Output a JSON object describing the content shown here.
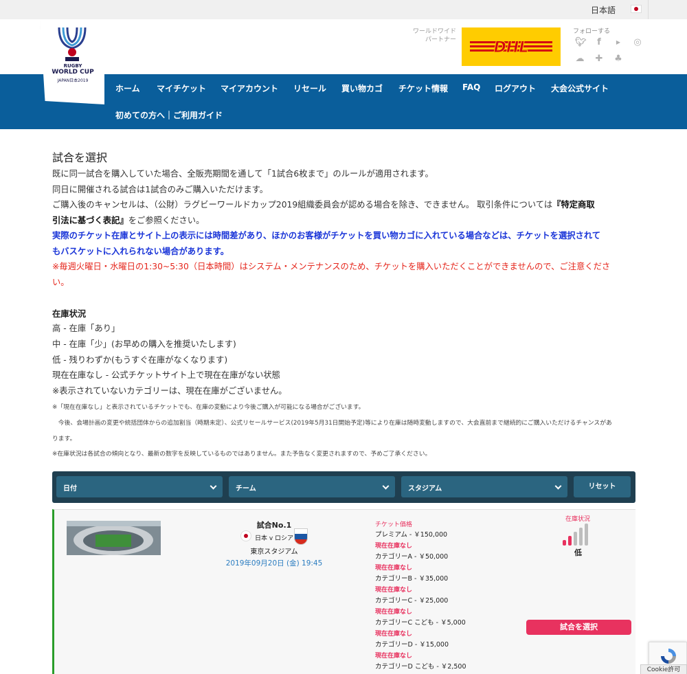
{
  "topbar": {
    "language": "日本語"
  },
  "logo": {
    "line1": "RUGBY",
    "line2": "WORLD CUP",
    "line3": "JAPAN日本2019"
  },
  "partner": {
    "label": "ワールドワイド パートナー",
    "sponsor": "DHL"
  },
  "social": {
    "label": "フォローする",
    "icons": [
      "twitter-icon",
      "facebook-icon",
      "youtube-icon",
      "instagram-icon",
      "soundcloud-icon",
      "plus-icon",
      "snapchat-icon"
    ]
  },
  "nav": {
    "items": [
      "ホーム",
      "マイチケット",
      "マイアカウント",
      "リセール",
      "買い物カゴ",
      "チケット情報",
      "FAQ",
      "ログアウト",
      "大会公式サイト"
    ],
    "guide": "初めての方へ｜ご利用ガイド"
  },
  "content": {
    "title": "試合を選択",
    "line1": "既に同一試合を購入していた場合、全販売期間を通して「1試合6枚まで」のルールが適用されます。",
    "line2": "同日に開催される試合は1試合のみご購入いただけます。",
    "line3a": "ご購入後のキャンセルは、（公財）ラグビーワールドカップ2019組織委員会が認める場合を除き、できません。 取引条件については",
    "line3b": "『特定商取",
    "line3c": "引法に基づく表記』",
    "line3d": "をご参照ください。",
    "blue1": "実際のチケット在庫とサイト上の表示には時間差があり、ほかのお客様がチケットを買い物カゴに入れている場合などは、チケットを選択されて",
    "blue2": "もバスケットに入れられない場合があります。",
    "red1": "※毎週火曜日・水曜日の1:30~5:30（日本時間）はシステム・メンテナンスのため、チケットを購入いただくことができませんので、ご注意くださ",
    "red2": "い。"
  },
  "stock_info": {
    "heading": "在庫状況",
    "lines": [
      "高 - 在庫「あり」",
      "中 - 在庫「少」(お早めの購入を推奨いたします)",
      "低 - 残りわずか(もうすぐ在庫がなくなります)",
      "現在在庫なし - 公式チケットサイト上で現在在庫がない状態",
      "※表示されていないカテゴリーは、現在在庫がございません。"
    ],
    "notes": [
      "※「現在在庫なし」と表示されているチケットでも、在庫の変動により今後ご購入が可能になる場合がございます。",
      "　今後、会場計画の変更や統括団体からの追加割当（時期未定）、公式リセールサービス(2019年5月31日開始予定)等により在庫は随時変動しますので、大会直前まで継続的にご購入いただけるチャンスがあ",
      "ります。",
      "※在庫状況は各試合の傾向となり、最新の数字を反映しているものではありません。また予告なく変更されますので、予めご了承ください。"
    ]
  },
  "filter": {
    "date": "日付",
    "team": "チーム",
    "stadium": "スタジアム",
    "reset": "リセット"
  },
  "match": {
    "number": "試合No.1",
    "teams": "日本 v ロシア",
    "venue": "東京スタジアム",
    "datetime": "2019年09月20日 (金) 19:45",
    "price_heading": "チケット価格",
    "prices": [
      {
        "name": "プレミアム - ￥150,000",
        "status": "現在在庫なし"
      },
      {
        "name": "カテゴリーA - ￥50,000",
        "status": "現在在庫なし"
      },
      {
        "name": "カテゴリーB - ￥35,000",
        "status": "現在在庫なし"
      },
      {
        "name": "カテゴリーC - ￥25,000",
        "status": "現在在庫なし"
      },
      {
        "name": "カテゴリーC こども - ￥5,000",
        "status": "現在在庫なし"
      },
      {
        "name": "カテゴリーD - ￥15,000",
        "status": "現在在庫なし"
      },
      {
        "name": "カテゴリーD こども - ￥2,500",
        "status": ""
      }
    ],
    "stock_label": "在庫状況",
    "stock_level": "低",
    "stock_bars": 2,
    "select_button": "試合を選択"
  },
  "cookie": "Cookie許可",
  "colors": {
    "nav": "#0a5e9b",
    "accent": "#e8325f",
    "filter": "#1f3f50",
    "dhl": "#ffcc00"
  }
}
